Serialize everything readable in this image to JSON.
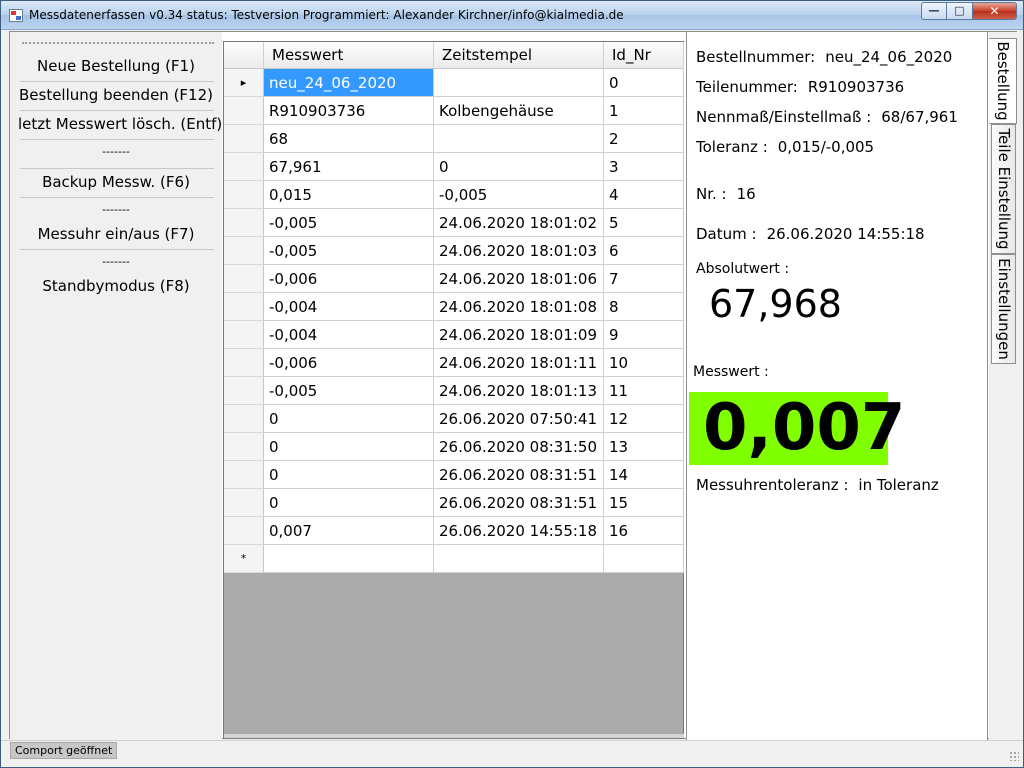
{
  "window": {
    "title": "Messdatenerfassen  v0.34  status: Testversion  Programmiert: Alexander Kirchner/info@kialmedia.de",
    "minimize_glyph": "—",
    "maximize_glyph": "□",
    "close_glyph": "✕"
  },
  "menu": {
    "items": [
      {
        "label": "Neue Bestellung (F1)"
      },
      {
        "label": "Bestellung beenden (F12)"
      },
      {
        "label": "letzt Messwert lösch. (Entf)"
      },
      {
        "label": "-------"
      },
      {
        "label": "Backup Messw. (F6)"
      },
      {
        "label": "-------"
      },
      {
        "label": "Messuhr ein/aus (F7)"
      },
      {
        "label": "-------"
      },
      {
        "label": "Standbymodus (F8)"
      }
    ]
  },
  "grid": {
    "columns": [
      "Messwert",
      "Zeitstempel",
      "Id_Nr"
    ],
    "current_row_marker": "▸",
    "new_row_marker": "*",
    "rows": [
      {
        "messwert": "neu_24_06_2020",
        "zeit": "",
        "id": "0"
      },
      {
        "messwert": "R910903736",
        "zeit": "Kolbengehäuse",
        "id": "1"
      },
      {
        "messwert": "68",
        "zeit": "",
        "id": "2"
      },
      {
        "messwert": "67,961",
        "zeit": "0",
        "id": "3"
      },
      {
        "messwert": "0,015",
        "zeit": "-0,005",
        "id": "4"
      },
      {
        "messwert": "-0,005",
        "zeit": "24.06.2020 18:01:02",
        "id": "5"
      },
      {
        "messwert": "-0,005",
        "zeit": "24.06.2020 18:01:03",
        "id": "6"
      },
      {
        "messwert": "-0,006",
        "zeit": "24.06.2020 18:01:06",
        "id": "7"
      },
      {
        "messwert": "-0,004",
        "zeit": "24.06.2020 18:01:08",
        "id": "8"
      },
      {
        "messwert": "-0,004",
        "zeit": "24.06.2020 18:01:09",
        "id": "9"
      },
      {
        "messwert": "-0,006",
        "zeit": "24.06.2020 18:01:11",
        "id": "10"
      },
      {
        "messwert": "-0,005",
        "zeit": "24.06.2020 18:01:13",
        "id": "11"
      },
      {
        "messwert": "0",
        "zeit": "26.06.2020 07:50:41",
        "id": "12"
      },
      {
        "messwert": "0",
        "zeit": "26.06.2020 08:31:50",
        "id": "13"
      },
      {
        "messwert": "0",
        "zeit": "26.06.2020 08:31:51",
        "id": "14"
      },
      {
        "messwert": "0",
        "zeit": "26.06.2020 08:31:51",
        "id": "15"
      },
      {
        "messwert": "0,007",
        "zeit": "26.06.2020 14:55:18",
        "id": "16"
      }
    ]
  },
  "info": {
    "bestellnummer_label": "Bestellnummer:",
    "bestellnummer_value": "neu_24_06_2020",
    "teilenummer_label": "Teilenummer:",
    "teilenummer_value": "R910903736",
    "nennmass_label": "Nennmaß/Einstellmaß :",
    "nennmass_value": "68/67,961",
    "toleranz_label": "Toleranz :",
    "toleranz_value": "0,015/-0,005",
    "nr_label": "Nr. :",
    "nr_value": "16",
    "datum_label": "Datum :",
    "datum_value": "26.06.2020 14:55:18",
    "absolutwert_label": "Absolutwert :",
    "absolutwert_value": "67,968",
    "messwert_label": "Messwert :",
    "messwert_value": "0,007",
    "messwert_color": "#80ff00",
    "messuhrtoleranz_label": "Messuhrentoleranz :",
    "messuhrtoleranz_value": "in Toleranz"
  },
  "tabs": [
    "Bestellung",
    "Teile Einstellung",
    "Einstellungen"
  ],
  "status": {
    "text": "Comport geöffnet"
  }
}
